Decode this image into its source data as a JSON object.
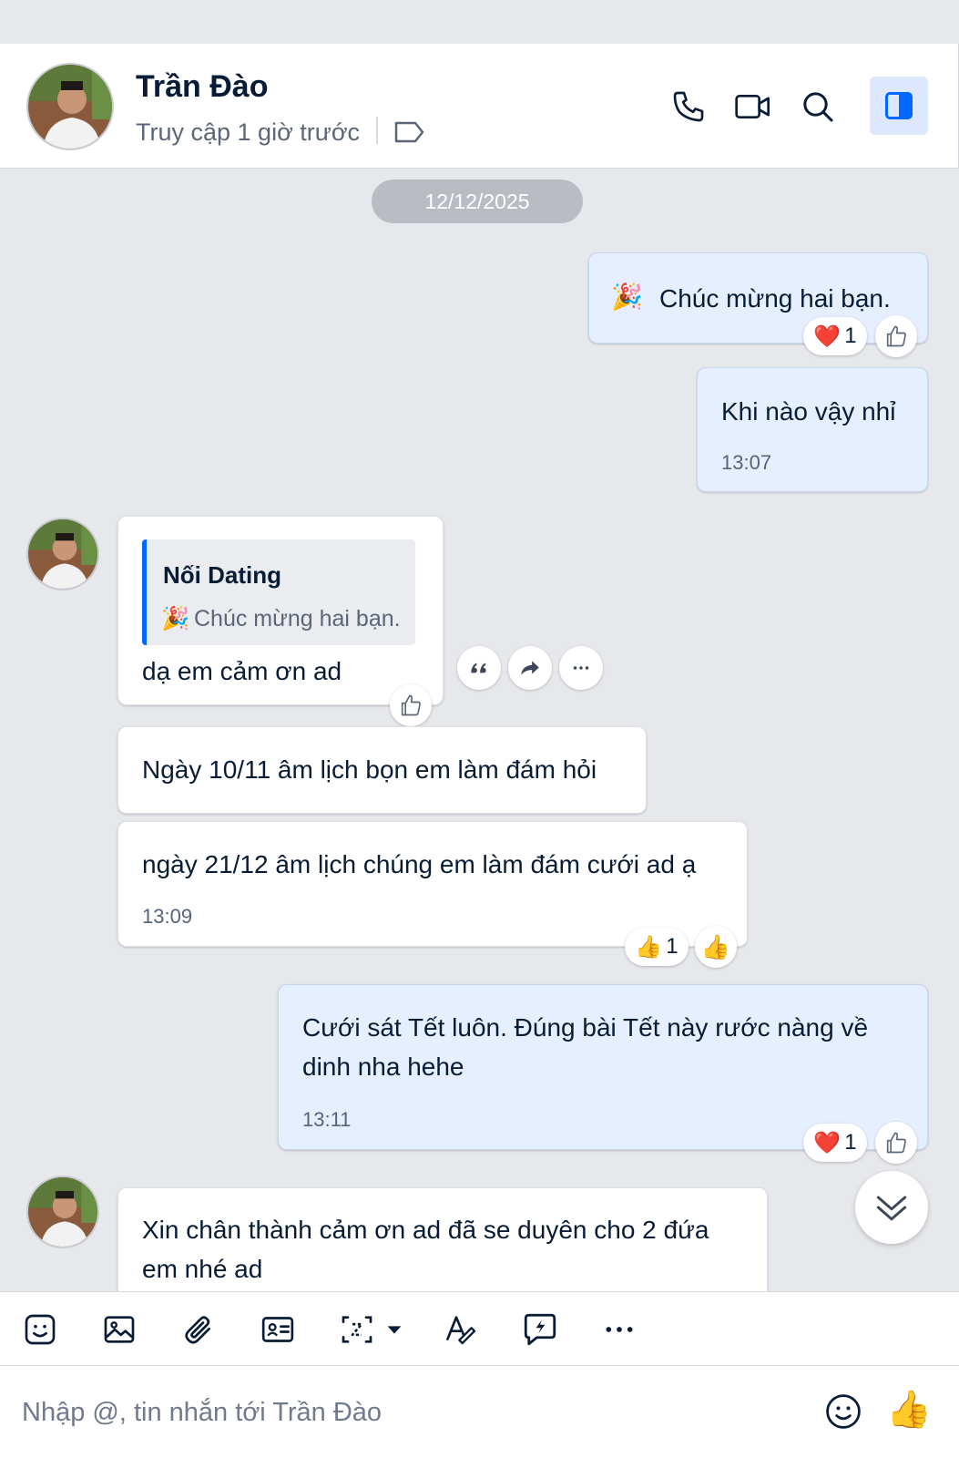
{
  "header": {
    "name": "Trần Đào",
    "status": "Truy cập 1 giờ trước"
  },
  "date_divider": "12/12/2025",
  "messages": [
    {
      "from": "me",
      "text": "Chúc mừng hai bạn.",
      "emoji": "🎉",
      "reaction": {
        "emoji": "❤️",
        "count": "1"
      }
    },
    {
      "from": "me",
      "text": "Khi nào vậy nhỉ",
      "time": "13:07"
    },
    {
      "from": "them",
      "quote": {
        "title": "Nối Dating",
        "emoji": "🎉",
        "text": "Chúc mừng hai bạn."
      },
      "text": "dạ em cảm ơn ad"
    },
    {
      "from": "them",
      "text": "Ngày 10/11 âm lịch bọn em làm đám hỏi"
    },
    {
      "from": "them",
      "text": "ngày 21/12 âm lịch chúng em làm đám cưới ad ạ",
      "time": "13:09",
      "reaction": {
        "emoji": "👍",
        "count": "1"
      }
    },
    {
      "from": "me",
      "text_line1": "Cưới sát Tết luôn. Đúng bài Tết này rước nàng về",
      "text_line2": "dinh nha hehe",
      "time": "13:11",
      "reaction": {
        "emoji": "❤️",
        "count": "1"
      }
    },
    {
      "from": "them",
      "text_line1": "Xin chân thành cảm ơn ad đã se duyên cho 2 đứa",
      "text_line2": "em nhé ad"
    }
  ],
  "quick_like_emoji": "👍",
  "toolbar": {
    "more_label": "···"
  },
  "composer": {
    "placeholder": "Nhập @, tin nhắn tới Trần Đào",
    "send_emoji": "👍"
  },
  "colors": {
    "accent": "#0068ff",
    "my_bubble": "#e5efff",
    "their_bubble": "#ffffff",
    "background": "#e6e8ec"
  },
  "icons": [
    "phone-icon",
    "video-icon",
    "search-icon",
    "sidebar-toggle-icon",
    "tag-icon",
    "sticker-icon",
    "image-icon",
    "attach-icon",
    "contact-card-icon",
    "screenshot-icon",
    "format-text-icon",
    "quick-message-icon",
    "more-icon",
    "emoji-icon",
    "like-icon",
    "quote-icon",
    "forward-icon",
    "chevron-down-double-icon"
  ]
}
